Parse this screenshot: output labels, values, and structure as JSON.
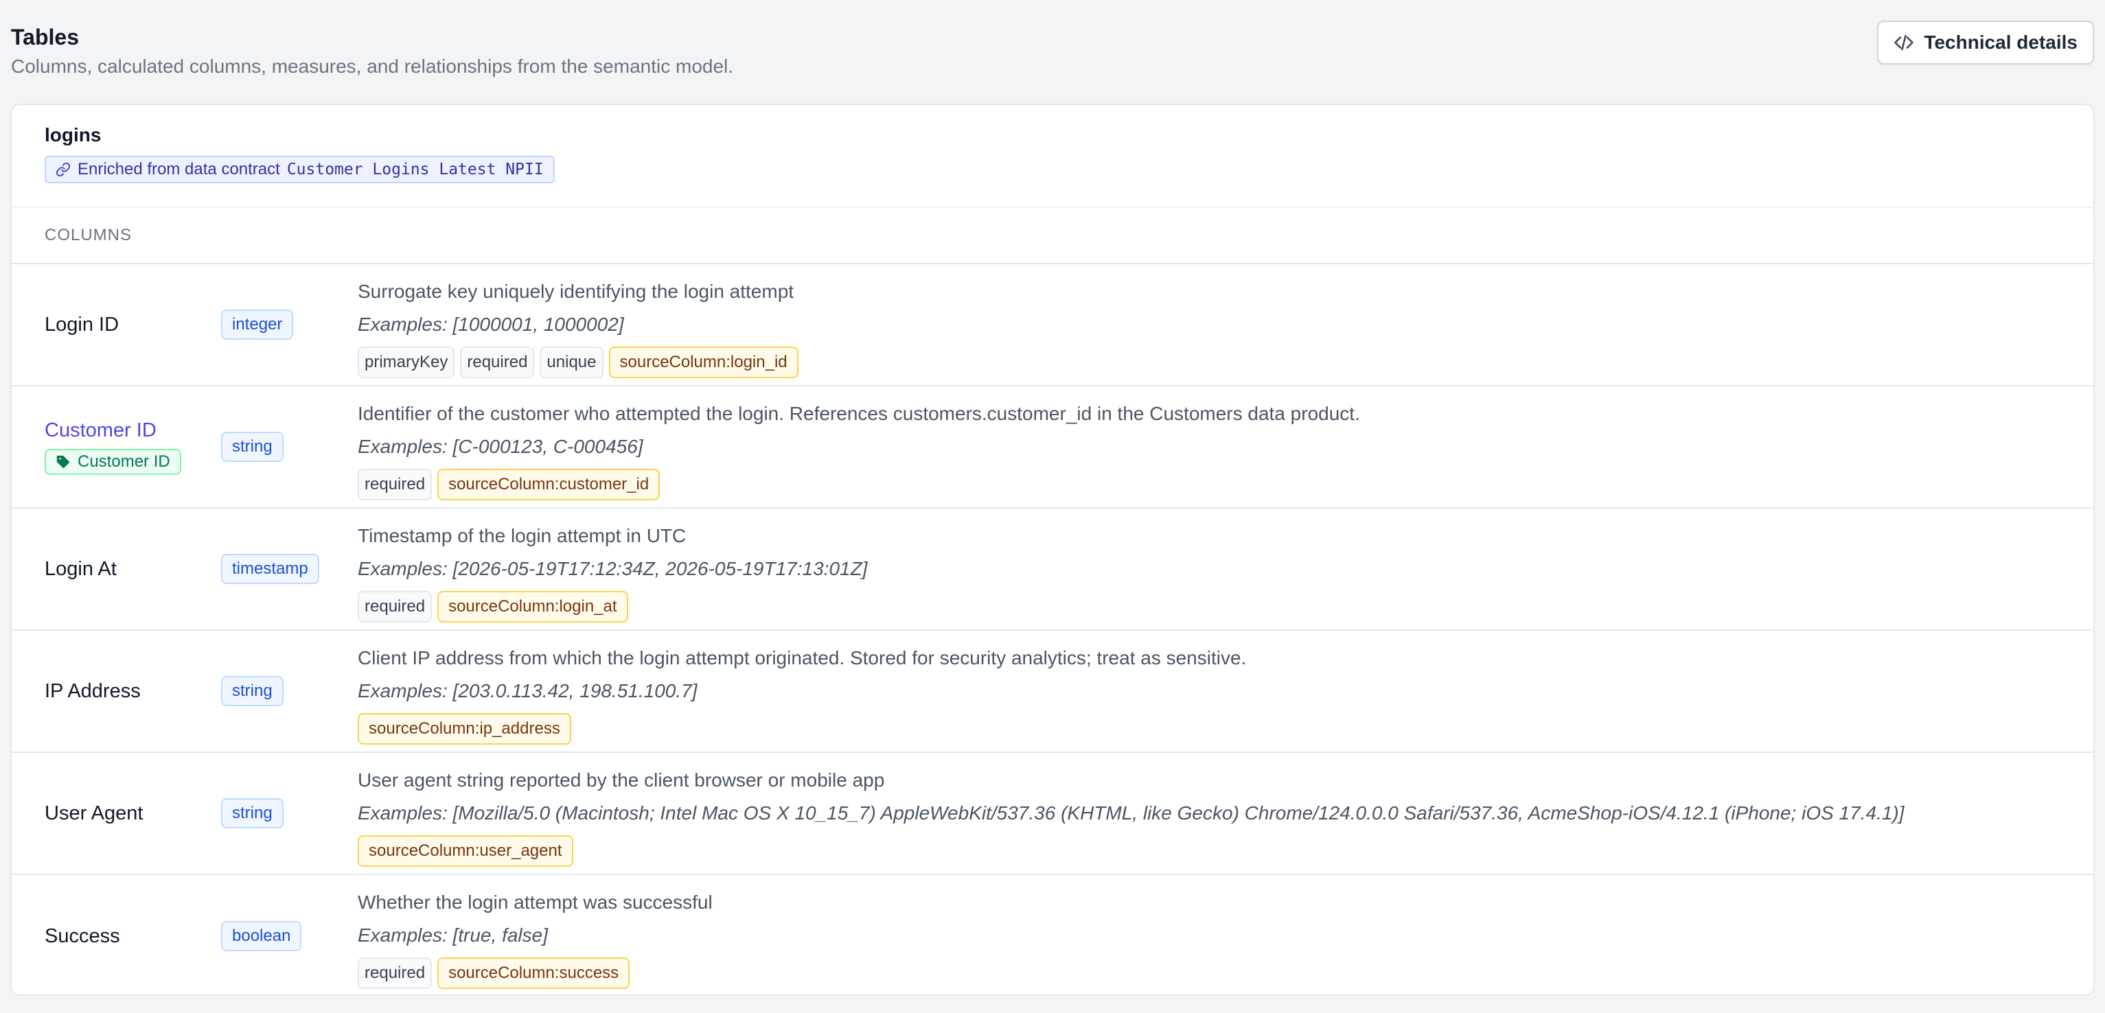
{
  "page": {
    "title": "Tables",
    "subtitle": "Columns, calculated columns, measures, and relationships from the semantic model."
  },
  "technical_details_button": {
    "label": "Technical details",
    "icon": "code-icon"
  },
  "table": {
    "name": "logins",
    "contract_badge": {
      "prefix": "Enriched from data contract",
      "contract_name": "Customer Logins Latest NPII",
      "icon": "link-icon"
    },
    "section_label": "COLUMNS",
    "columns": [
      {
        "name": "Login ID",
        "type": "integer",
        "description": "Surrogate key uniquely identifying the login attempt",
        "examples": "Examples: [1000001, 1000002]",
        "tags": [
          "primaryKey",
          "required",
          "unique"
        ],
        "source": "sourceColumn:login_id"
      },
      {
        "name": "Customer ID",
        "semantic_tag": "Customer ID",
        "type": "string",
        "description": "Identifier of the customer who attempted the login. References customers.customer_id in the Customers data product.",
        "examples": "Examples: [C-000123, C-000456]",
        "tags": [
          "required"
        ],
        "source": "sourceColumn:customer_id"
      },
      {
        "name": "Login At",
        "type": "timestamp",
        "description": "Timestamp of the login attempt in UTC",
        "examples": "Examples: [2026-05-19T17:12:34Z, 2026-05-19T17:13:01Z]",
        "tags": [
          "required"
        ],
        "source": "sourceColumn:login_at"
      },
      {
        "name": "IP Address",
        "type": "string",
        "description": "Client IP address from which the login attempt originated. Stored for security analytics; treat as sensitive.",
        "examples": "Examples: [203.0.113.42, 198.51.100.7]",
        "tags": [],
        "source": "sourceColumn:ip_address"
      },
      {
        "name": "User Agent",
        "type": "string",
        "description": "User agent string reported by the client browser or mobile app",
        "examples": "Examples: [Mozilla/5.0 (Macintosh; Intel Mac OS X 10_15_7) AppleWebKit/537.36 (KHTML, like Gecko) Chrome/124.0.0.0 Safari/537.36, AcmeShop-iOS/4.12.1 (iPhone; iOS 17.4.1)]",
        "tags": [],
        "source": "sourceColumn:user_agent"
      },
      {
        "name": "Success",
        "type": "boolean",
        "description": "Whether the login attempt was successful",
        "examples": "Examples: [true, false]",
        "tags": [
          "required"
        ],
        "source": "sourceColumn:success"
      }
    ]
  },
  "colors": {
    "link": "#4f46e5",
    "type_badge": "#1d4ed8",
    "semantic_tag": "#047857",
    "source_tag_bg": "#fffbeb"
  }
}
